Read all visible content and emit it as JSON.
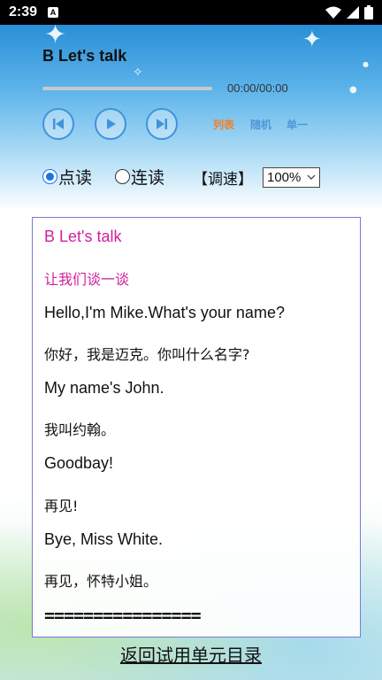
{
  "status_bar": {
    "time": "2:39",
    "notification_letter": "A"
  },
  "player": {
    "title": "B Let's talk",
    "time_display": "00:00/00:00",
    "progress": 0,
    "modes": [
      "列表",
      "随机",
      "单一"
    ],
    "mode_colors": [
      "#f0802a",
      "#4f97d9",
      "#4f97d9"
    ]
  },
  "reading": {
    "options": [
      "点读",
      "连读"
    ],
    "selected": "点读",
    "speed_label": "【调速】",
    "speed_value": "100%"
  },
  "content": {
    "lines": [
      "B Let's talk",
      "让我们谈一谈",
      "Hello,I'm Mike.What's your name?",
      "你好，我是迈克。你叫什么名字?",
      "My name's John.",
      "我叫约翰。",
      "Goodbay!",
      "再见!",
      "Bye, Miss White.",
      "再见，怀特小姐。"
    ],
    "separator": "================"
  },
  "footer": {
    "back_link": "返回试用单元目录"
  },
  "colors": {
    "accent": "#3f93dd",
    "pink": "#d01f9e",
    "box_border": "#7a79d6"
  }
}
